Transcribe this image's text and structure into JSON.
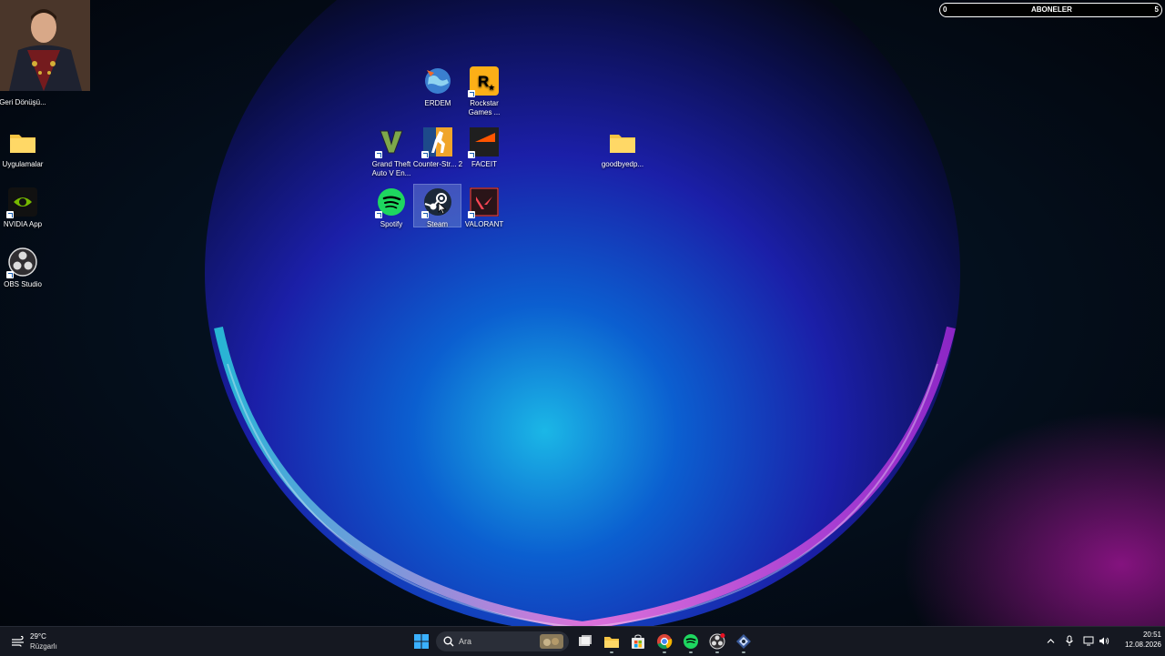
{
  "subscriber_widget": {
    "left_value": "0",
    "title": "ABONELER",
    "right_value": "5"
  },
  "desktop_icons": {
    "recycle": "Geri Dönüşü...",
    "uygulamalar": "Uygulamalar",
    "nvidia": "NVIDIA App",
    "obs": "OBS Studio",
    "erdem": "ERDEM",
    "rockstar": "Rockstar Games ...",
    "gta": "Grand Theft Auto V En...",
    "cs2": "Counter-Str... 2",
    "faceit": "FACEIT",
    "goodbye": "goodbyedp...",
    "spotify": "Spotify",
    "steam": "Steam",
    "valorant": "VALORANT"
  },
  "taskbar": {
    "weather_temp": "29°C",
    "weather_desc": "Rüzgarlı",
    "search_placeholder": "Ara",
    "time": "20:51",
    "date": "12.08.2026"
  },
  "colors": {
    "taskbar_bg": "#151821",
    "accent": "#0078d4"
  }
}
